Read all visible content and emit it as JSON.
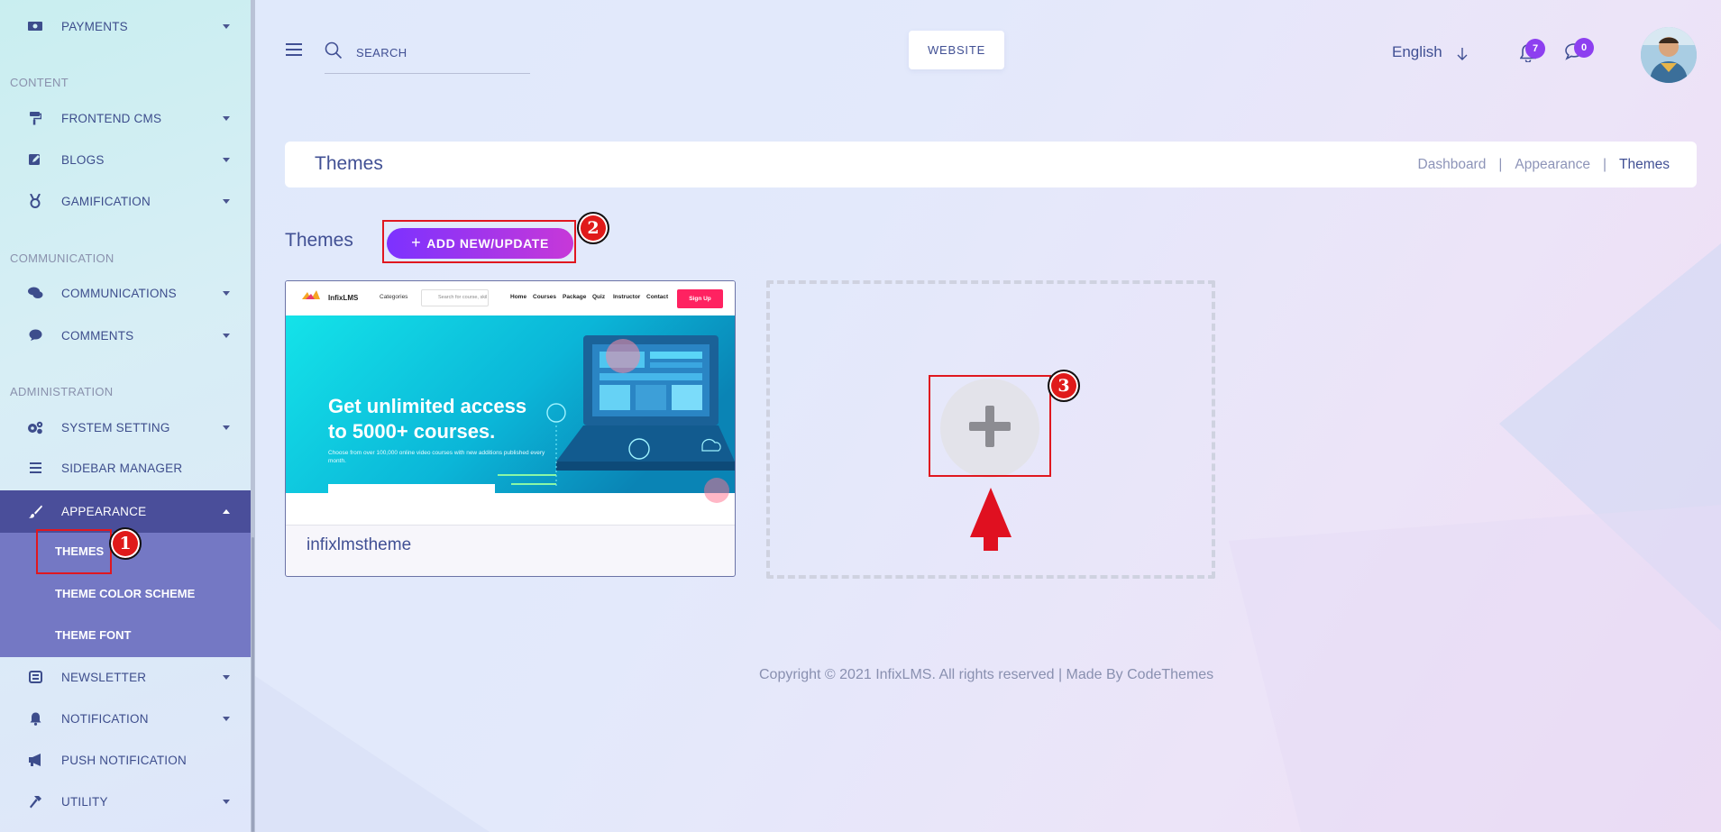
{
  "sidebar": {
    "items": [
      {
        "label": "PAYMENTS",
        "icon": "money-icon",
        "has_caret": true
      },
      {
        "label": "FRONTEND CMS",
        "icon": "paint-roller-icon",
        "has_caret": true
      },
      {
        "label": "BLOGS",
        "icon": "edit-icon",
        "has_caret": true
      },
      {
        "label": "GAMIFICATION",
        "icon": "medal-icon",
        "has_caret": true
      },
      {
        "label": "COMMUNICATIONS",
        "icon": "comments-icon",
        "has_caret": true
      },
      {
        "label": "COMMENTS",
        "icon": "comment-icon",
        "has_caret": true
      },
      {
        "label": "SYSTEM SETTING",
        "icon": "cogs-icon",
        "has_caret": true
      },
      {
        "label": "SIDEBAR MANAGER",
        "icon": "bars-icon",
        "has_caret": false
      },
      {
        "label": "APPEARANCE",
        "icon": "brush-icon",
        "has_caret": true,
        "active": true
      },
      {
        "label": "NEWSLETTER",
        "icon": "newsletter-icon",
        "has_caret": true
      },
      {
        "label": "NOTIFICATION",
        "icon": "bell-icon",
        "has_caret": true
      },
      {
        "label": "PUSH NOTIFICATION",
        "icon": "megaphone-icon",
        "has_caret": false
      },
      {
        "label": "UTILITY",
        "icon": "hammer-icon",
        "has_caret": true
      }
    ],
    "sections": {
      "content": "CONTENT",
      "communication": "COMMUNICATION",
      "administration": "ADMINISTRATION"
    },
    "appearance_sub": [
      "THEMES",
      "THEME COLOR SCHEME",
      "THEME FONT"
    ]
  },
  "header": {
    "search_placeholder": "SEARCH",
    "website_label": "WEBSITE",
    "language": "English",
    "notification_count": "7",
    "message_count": "0"
  },
  "page": {
    "title": "Themes",
    "breadcrumb": [
      "Dashboard",
      "Appearance",
      "Themes"
    ],
    "breadcrumb_sep": "|",
    "section_title": "Themes",
    "add_button_label": "ADD NEW/UPDATE",
    "add_button_plus": "+"
  },
  "theme_card": {
    "name": "infixlmstheme",
    "preview": {
      "logo": "InfixLMS",
      "categories": "Categories",
      "search_placeholder": "Search for course, skil",
      "nav": [
        "Home",
        "Courses",
        "Package",
        "Quiz",
        "Instructor",
        "Contact"
      ],
      "signup": "Sign Up",
      "hero_line1": "Get unlimited access",
      "hero_line2": "to 5000+ courses.",
      "hero_sub": "Choose from over 100,000 online video courses with new additions published every month."
    }
  },
  "annotations": [
    "1",
    "2",
    "3"
  ],
  "footer": "Copyright © 2021 InfixLMS. All rights reserved | Made By CodeThemes",
  "colors": {
    "accent_start": "#7c32ff",
    "accent_end": "#c738d8",
    "sidebar_active": "#4a4e9a",
    "sidebar_sub": "#7478c4",
    "annotation_red": "#e0171f",
    "text_primary": "#415094"
  }
}
